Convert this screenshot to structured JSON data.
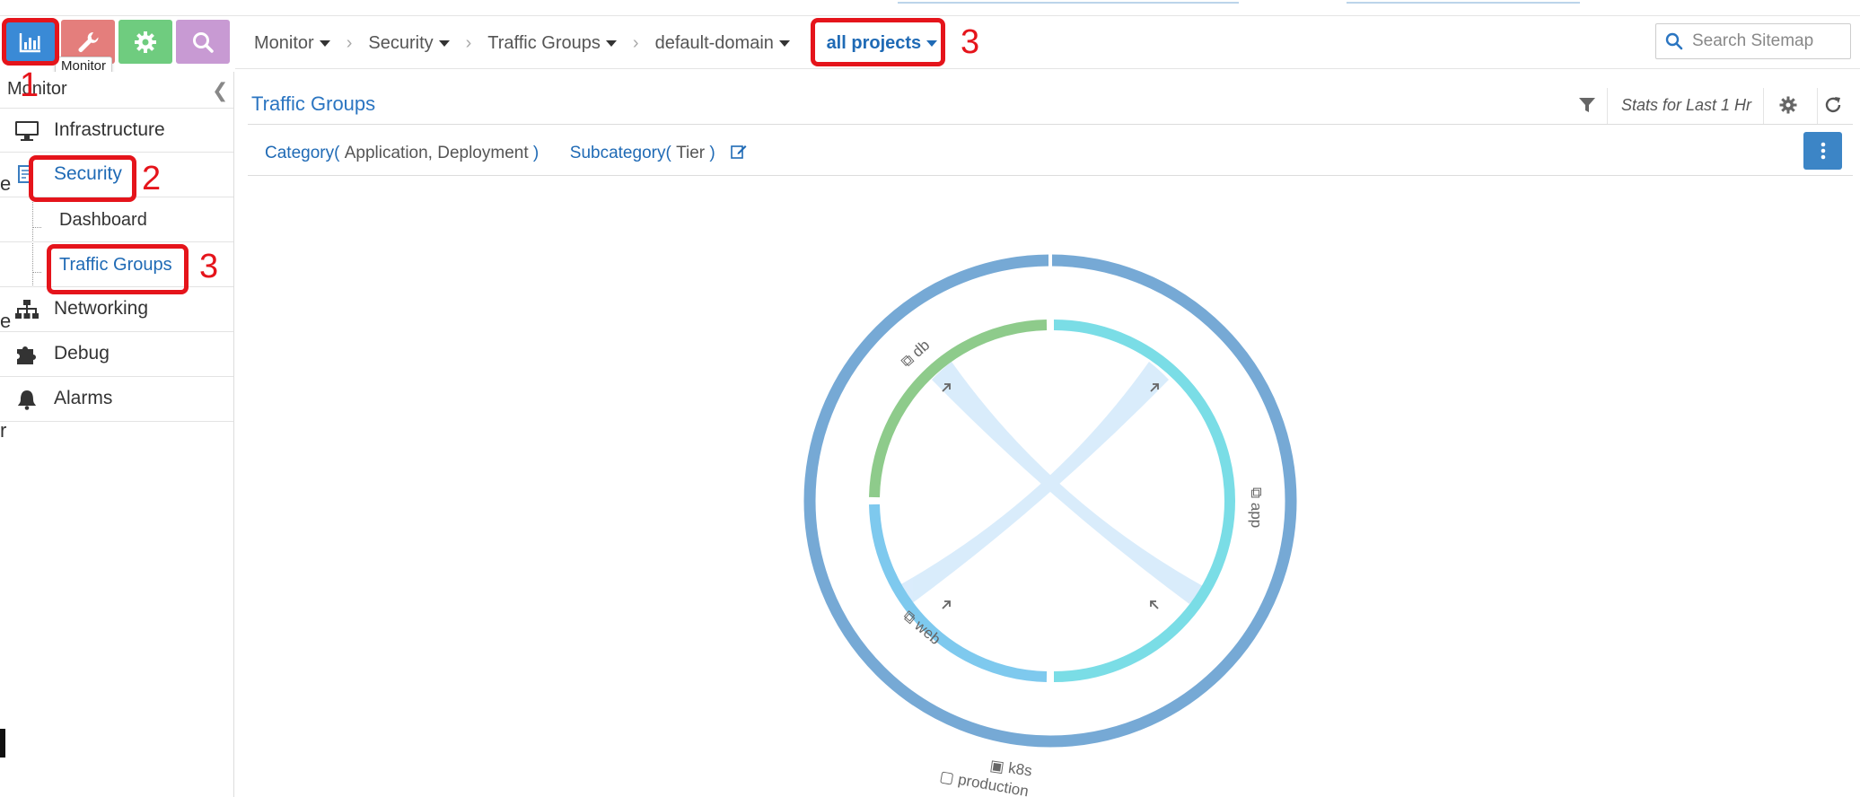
{
  "nav": {
    "tooltip": "Monitor",
    "buttons": [
      {
        "name": "monitor",
        "icon": "bar-chart-icon",
        "color": "#3a8ad6"
      },
      {
        "name": "configure",
        "icon": "wrench-icon",
        "color": "#e47e7c"
      },
      {
        "name": "settings",
        "icon": "gear-icon",
        "color": "#6fcc7f"
      },
      {
        "name": "query",
        "icon": "search-icon",
        "color": "#c89ad3"
      }
    ]
  },
  "sidebar": {
    "title": "Monitor",
    "items": [
      {
        "label": "Infrastructure",
        "icon": "monitor-icon"
      },
      {
        "label": "Security",
        "icon": "security-icon"
      },
      {
        "label": "Dashboard"
      },
      {
        "label": "Traffic Groups"
      },
      {
        "label": "Networking",
        "icon": "sitemap-icon"
      },
      {
        "label": "Debug",
        "icon": "puzzle-icon"
      },
      {
        "label": "Alarms",
        "icon": "bell-icon"
      }
    ]
  },
  "edge_fragments": [
    "e",
    "e",
    "r"
  ],
  "breadcrumb": {
    "items": [
      "Monitor",
      "Security",
      "Traffic Groups",
      "default-domain",
      "all projects"
    ]
  },
  "search": {
    "placeholder": "Search Sitemap"
  },
  "page": {
    "title": "Traffic Groups",
    "stats": "Stats for Last 1 Hr",
    "category_label": "Category",
    "category_open": "(",
    "category_value": "Application, Deployment",
    "category_close": ")",
    "subcategory_label": "Subcategory",
    "subcategory_open": "(",
    "subcategory_value": "Tier",
    "subcategory_close": ")"
  },
  "annotations": [
    "1",
    "2",
    "3",
    "3"
  ],
  "chart_data": {
    "type": "chord",
    "outer_groups": [
      {
        "name": "k8s",
        "sub": "production",
        "color": "#76a9d5"
      }
    ],
    "inner_groups": [
      {
        "name": "db",
        "color": "#8ecb8b"
      },
      {
        "name": "app",
        "color": "#7adde6"
      },
      {
        "name": "web",
        "color": "#7ec9ee"
      }
    ],
    "ribbon_color": "#d3e9fb"
  }
}
